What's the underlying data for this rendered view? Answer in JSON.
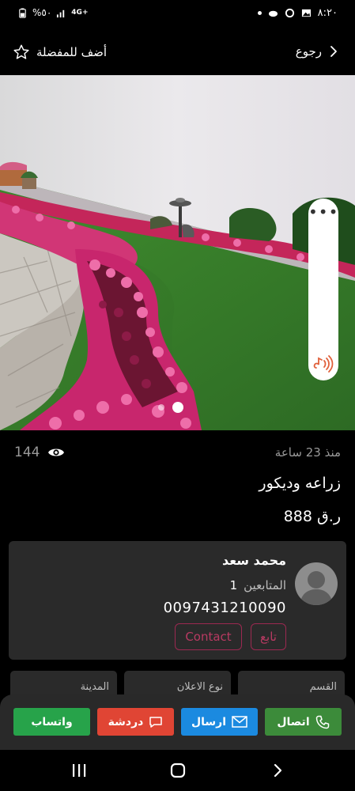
{
  "status_bar": {
    "time": "٨:٢٠",
    "battery": "%٥٠",
    "network": "4G+"
  },
  "top_bar": {
    "favorite_label": "أضف للمفضلة",
    "back_label": "رجوع"
  },
  "gallery": {
    "total_images": 2,
    "active_index": 2,
    "audio_icon": "audio-speaker-icon",
    "more_icon": "more-dots-icon"
  },
  "listing": {
    "views": "144",
    "posted": "منذ 23 ساعة",
    "title": "زراعه وديكور",
    "price": "888 ر.ق"
  },
  "seller": {
    "name": "محمد سعد",
    "followers_label": "المتابعين",
    "followers_count": "1",
    "phone": "0097431210090",
    "follow_label": "تابع",
    "contact_label": "Contact"
  },
  "info_cards": {
    "category": "القسم",
    "ad_type": "نوع الاعلان",
    "city": "المدينة"
  },
  "actions": {
    "call": "اتصال",
    "send": "ارسال",
    "chat": "دردشة",
    "whatsapp": "واتساب"
  },
  "colors": {
    "accent": "#9c2951",
    "whatsapp": "#27a34a",
    "chat": "#e04534",
    "send": "#1b8ae0",
    "call": "#3c8b3a",
    "card_bg": "#2a2a2a"
  }
}
